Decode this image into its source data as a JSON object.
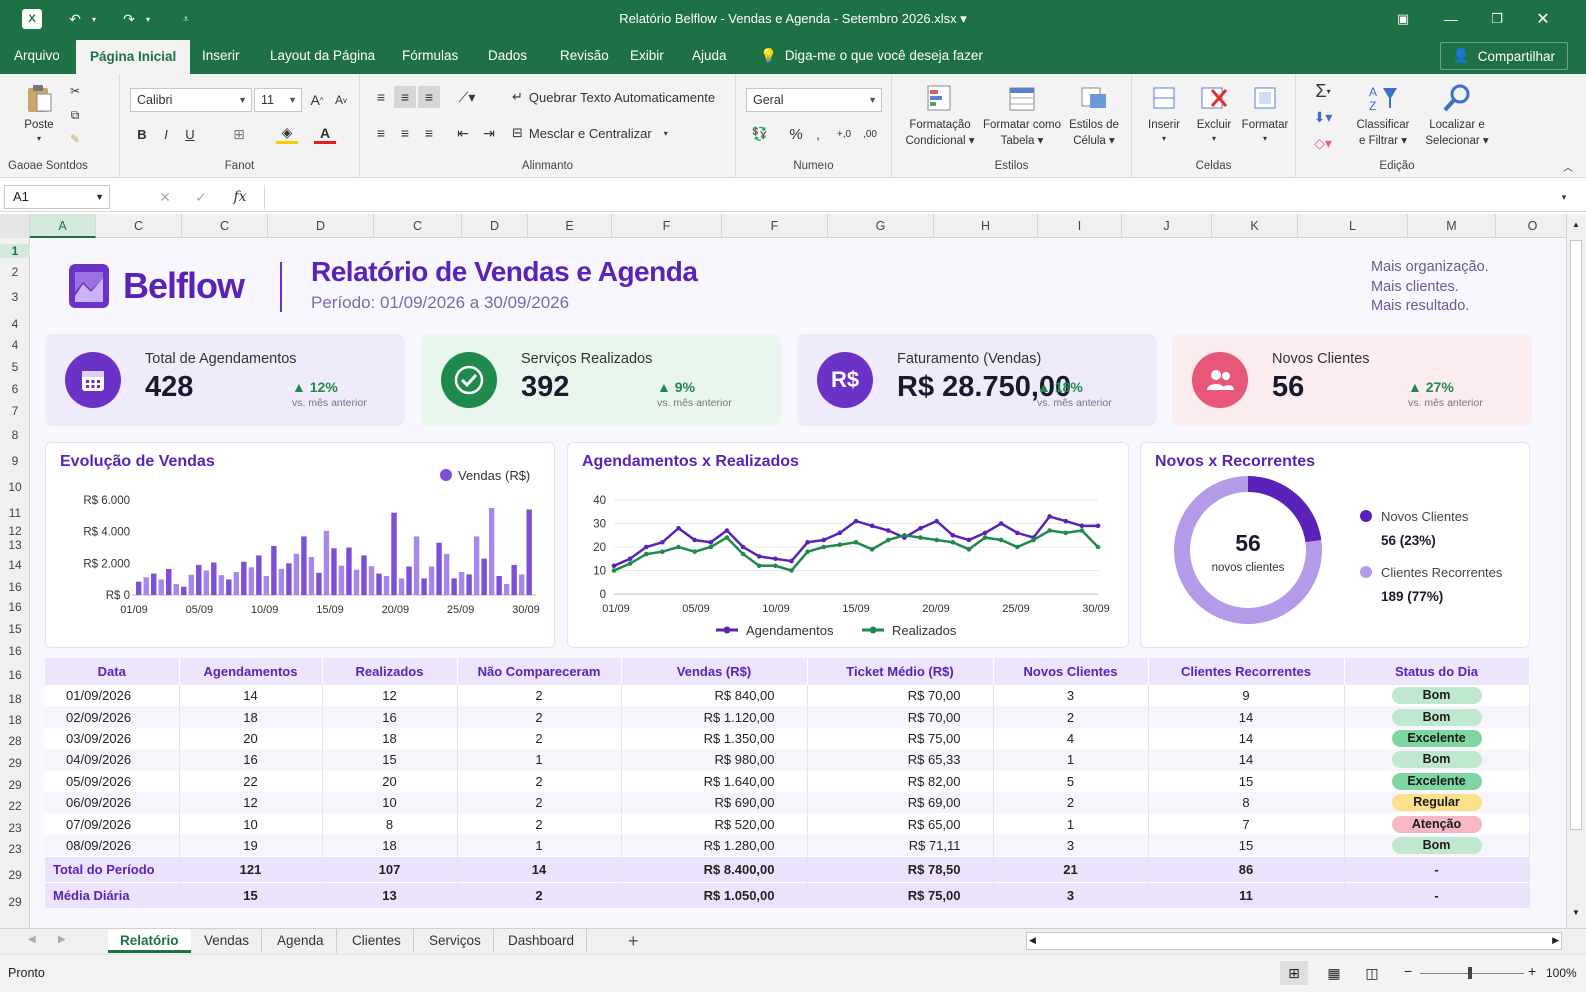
{
  "window": {
    "title": "Relatório Belflow - Vendas e Agenda - Setembro 2026.xlsx",
    "app_icon": "excel-icon",
    "accent": "#1e7145"
  },
  "menu": {
    "tabs": [
      "Arquivo",
      "Página Inicial",
      "Inserir",
      "Layout da Página",
      "Fórmulas",
      "Dados",
      "Revisão",
      "Exibir",
      "Ajuda"
    ],
    "active": "Página Inicial",
    "tell_me": "Diga-me o que você deseja fazer",
    "share": "Compartilhar"
  },
  "ribbon": {
    "clipboard": {
      "paste": "Poste",
      "label": "Gaoae Sontdos"
    },
    "font": {
      "name": "Calibri",
      "size": "11",
      "label": "Fanot",
      "bold": "B",
      "italic": "I",
      "underline": "U",
      "grow": "A",
      "shrink": "A"
    },
    "alignment": {
      "wrap": "Quebrar Texto Automaticamente",
      "merge": "Mesclar e Centralizar",
      "label": "Alinmanto"
    },
    "number": {
      "format": "Geral",
      "percent": "%",
      "label": "Numeıo",
      "inc_decimal": "+,0",
      "dec_decimal": ",00"
    },
    "styles": {
      "cond": [
        "Formatação",
        "Condicional"
      ],
      "table": [
        "Formatar como",
        "Tabela"
      ],
      "cell": [
        "Estilos de",
        "Célula"
      ],
      "label": "Estilos"
    },
    "cells": {
      "insert": "Inserir",
      "delete": "Excluir",
      "format": "Formatar",
      "label": "Celdas"
    },
    "editing": {
      "sort": [
        "Classificar",
        "e Filtrar"
      ],
      "find": [
        "Localizar e",
        "Selecionar"
      ],
      "sum": "Σ",
      "label": "Edição"
    }
  },
  "formula_bar": {
    "cell_ref": "A1",
    "fx": "fx",
    "content": ""
  },
  "columns": [
    "A",
    "C",
    "C",
    "D",
    "C",
    "D",
    "E",
    "F",
    "F",
    "G",
    "H",
    "I",
    "J",
    "K",
    "L",
    "M",
    "O"
  ],
  "rows": [
    "1",
    "2",
    "3",
    "4",
    "4",
    "5",
    "6",
    "7",
    "8",
    "9",
    "10",
    "11",
    "12",
    "13",
    "14",
    "16",
    "16",
    "15",
    "16",
    "16",
    "18",
    "18",
    "28",
    "29",
    "29",
    "22",
    "23",
    "23",
    "29",
    "29"
  ],
  "brand": {
    "name": "Belflow",
    "color": "#5a22b8"
  },
  "report": {
    "title": "Relatório de Vendas e Agenda",
    "period": "Período: 01/09/2026 a 30/09/2026",
    "slogan": [
      "Mais organização.",
      "Mais clientes.",
      "Mais resultado."
    ]
  },
  "kpis": [
    {
      "label": "Total de Agendamentos",
      "value": "428",
      "delta": "▲ 12%",
      "note": "vs. mês anterior",
      "icon": "calendar-icon",
      "color": "#6b32c8",
      "bg": "#efebfb"
    },
    {
      "label": "Serviços Realizados",
      "value": "392",
      "delta": "▲ 9%",
      "note": "vs. mês anterior",
      "icon": "check-circle-icon",
      "color": "#1e8a4c",
      "bg": "#e9f6ee"
    },
    {
      "label": "Faturamento (Vendas)",
      "value": "R$ 28.750,00",
      "delta": "▲ 18%",
      "note": "vs. mês anterior",
      "icon": "currency-icon",
      "icon_text": "R$",
      "color": "#6b32c8",
      "bg": "#efebfb"
    },
    {
      "label": "Novos Clientes",
      "value": "56",
      "delta": "▲ 27%",
      "note": "vs. mês anterior",
      "icon": "users-icon",
      "color": "#e8577a",
      "bg": "#fbecef"
    }
  ],
  "chart_data": [
    {
      "type": "bar",
      "title": "Evolução de Vendas",
      "legend": "top-right",
      "categories": [
        "01/09",
        "02/09",
        "03/09",
        "04/09",
        "05/09",
        "06/09",
        "07/09",
        "08/09",
        "09/09",
        "10/09",
        "11/09",
        "12/09",
        "13/09",
        "14/09",
        "15/09",
        "16/09",
        "17/09",
        "18/09",
        "19/09",
        "20/09",
        "21/09",
        "22/09",
        "23/09",
        "24/09",
        "25/09",
        "26/09",
        "27/09",
        "28/09",
        "29/09",
        "30/09"
      ],
      "x_ticks": [
        "01/09",
        "05/09",
        "10/09",
        "15/09",
        "20/09",
        "25/09",
        "30/09"
      ],
      "y_ticks": [
        "R$ 0",
        "R$ 2.000",
        "R$ 4.000",
        "R$ 6.000"
      ],
      "ylim": [
        0,
        6000
      ],
      "series": [
        {
          "name": "Vendas (R$)",
          "color": "#7d4fd6",
          "color2": "#a788ea",
          "values": [
            840,
            1120,
            1350,
            980,
            1640,
            690,
            520,
            1280,
            1900,
            1550,
            2050,
            1250,
            980,
            1450,
            2100,
            1750,
            2500,
            1200,
            3100,
            1650,
            2000,
            2600,
            3700,
            2400,
            1400,
            4050,
            2950,
            1850,
            3000,
            1600,
            2500,
            1820,
            1350,
            1200,
            5200,
            1050,
            1800,
            3700,
            1050,
            1800,
            3300,
            2600,
            1050,
            1450,
            1300,
            3700,
            2300,
            5500,
            1200,
            700,
            1900,
            1300,
            5400
          ]
        }
      ]
    },
    {
      "type": "line",
      "title": "Agendamentos x Realizados",
      "legend": "bottom",
      "x_ticks": [
        "01/09",
        "05/09",
        "10/09",
        "15/09",
        "20/09",
        "25/09",
        "30/09"
      ],
      "ylim": [
        0,
        40
      ],
      "y_ticks": [
        "0",
        "10",
        "20",
        "30",
        "40"
      ],
      "series": [
        {
          "name": "Agendamentos",
          "color": "#5a22b8",
          "values": [
            12,
            15,
            20,
            22,
            28,
            23,
            22,
            27,
            20,
            16,
            15,
            14,
            22,
            23,
            26,
            31,
            29,
            27,
            24,
            28,
            31,
            25,
            23,
            26,
            30,
            26,
            24,
            33,
            31,
            29,
            29
          ]
        },
        {
          "name": "Realizados",
          "color": "#1e8a4c",
          "values": [
            10,
            13,
            17,
            18,
            20,
            18,
            20,
            24,
            17,
            12,
            12,
            10,
            18,
            20,
            21,
            22,
            19,
            23,
            25,
            24,
            23,
            22,
            19,
            24,
            23,
            20,
            23,
            27,
            26,
            27,
            20
          ]
        }
      ]
    },
    {
      "type": "pie",
      "title": "Novos x Recorrentes",
      "center_value": "56",
      "center_label": "novos clientes",
      "legend": "right",
      "slices": [
        {
          "name": "Novos Clientes",
          "value": 56,
          "display": "56 (23%)",
          "color": "#5a22b8"
        },
        {
          "name": "Clientes Recorrentes",
          "value": 189,
          "display": "189 (77%)",
          "color": "#b59ae8"
        }
      ]
    }
  ],
  "table": {
    "headers": [
      "Data",
      "Agendamentos",
      "Realizados",
      "Não Compareceram",
      "Vendas (R$)",
      "Ticket Médio (R$)",
      "Novos Clientes",
      "Clientes Recorrentes",
      "Status do Dia"
    ],
    "rows": [
      [
        "01/09/2026",
        "14",
        "12",
        "2",
        "R$  840,00",
        "R$ 70,00",
        "3",
        "9",
        "Bom"
      ],
      [
        "02/09/2026",
        "18",
        "16",
        "2",
        "R$  1.120,00",
        "R$ 70,00",
        "2",
        "14",
        "Bom"
      ],
      [
        "03/09/2026",
        "20",
        "18",
        "2",
        "R$  1.350,00",
        "R$ 75,00",
        "4",
        "14",
        "Excelente"
      ],
      [
        "04/09/2026",
        "16",
        "15",
        "1",
        "R$  980,00",
        "R$ 65,33",
        "1",
        "14",
        "Bom"
      ],
      [
        "05/09/2026",
        "22",
        "20",
        "2",
        "R$  1.640,00",
        "R$ 82,00",
        "5",
        "15",
        "Excelente"
      ],
      [
        "06/09/2026",
        "12",
        "10",
        "2",
        "R$  690,00",
        "R$ 69,00",
        "2",
        "8",
        "Regular"
      ],
      [
        "07/09/2026",
        "10",
        "8",
        "2",
        "R$  520,00",
        "R$ 65,00",
        "1",
        "7",
        "Atenção"
      ],
      [
        "08/09/2026",
        "19",
        "18",
        "1",
        "R$  1.280,00",
        "R$ 71,11",
        "3",
        "15",
        "Bom"
      ]
    ],
    "totals": [
      "Total do Período",
      "121",
      "107",
      "14",
      "R$ 8.400,00",
      "R$ 78,50",
      "21",
      "86",
      "-"
    ],
    "averages": [
      "Média Diária",
      "15",
      "13",
      "2",
      "R$ 1.050,00",
      "R$ 75,00",
      "3",
      "11",
      "-"
    ],
    "status_colors": {
      "Bom": "#bfe8cf",
      "Excelente": "#7fd6a3",
      "Regular": "#fbe08c",
      "Atenção": "#f6b8c4"
    }
  },
  "sheet_tabs": [
    "Relatório",
    "Vendas",
    "Agenda",
    "Clientes",
    "Serviços",
    "Dashboard"
  ],
  "active_sheet": "Relatório",
  "status": {
    "mode": "Pronto",
    "zoom": "100%"
  }
}
